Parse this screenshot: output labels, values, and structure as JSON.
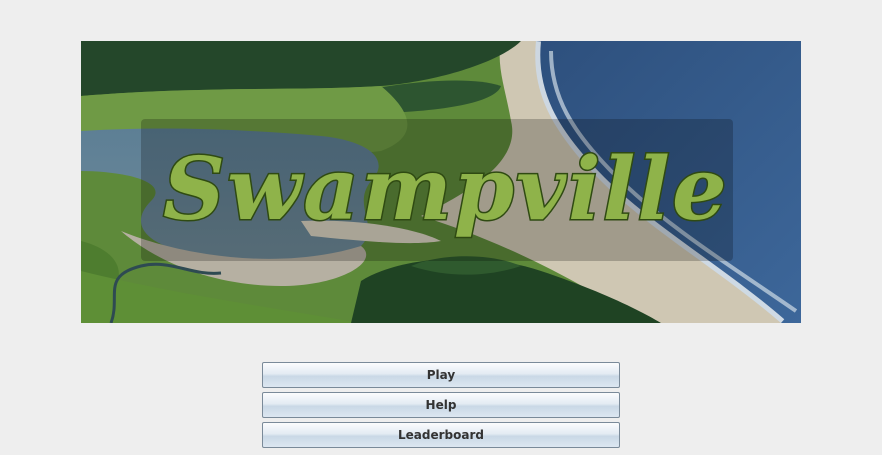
{
  "banner": {
    "logo_text": "Swampville"
  },
  "menu": {
    "play_label": "Play",
    "help_label": "Help",
    "leaderboard_label": "Leaderboard"
  }
}
